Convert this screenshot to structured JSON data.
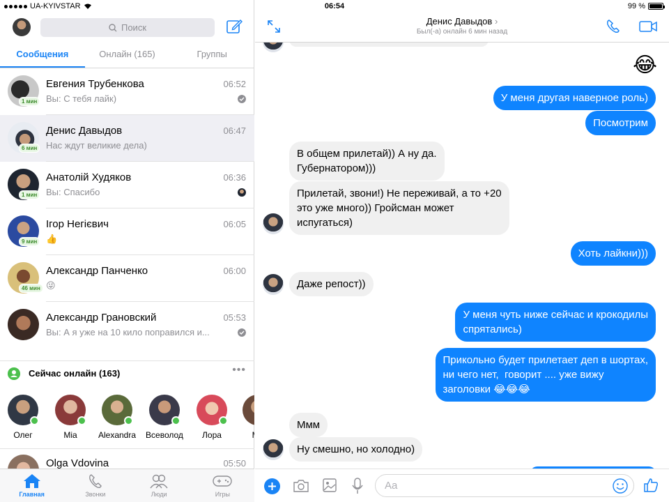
{
  "status_bar": {
    "carrier": "UA-KYIVSTAR",
    "time": "06:54",
    "battery": "99 %",
    "battery_level": 0.99
  },
  "sidebar": {
    "search_placeholder": "Поиск",
    "tabs": [
      {
        "label": "Сообщения",
        "active": true
      },
      {
        "label": "Онлайн (165)",
        "active": false
      },
      {
        "label": "Группы",
        "active": false
      }
    ],
    "conversations": [
      {
        "name": "Евгения Трубенкова",
        "preview": "Вы: С тебя лайк)",
        "time": "06:52",
        "active_badge": "1 мин",
        "status": "sent-check",
        "selected": false
      },
      {
        "name": "Денис Давыдов",
        "preview": "Нас ждут великие дела)",
        "time": "06:47",
        "active_badge": "6 мин",
        "status": "",
        "selected": true
      },
      {
        "name": "Анатолій Худяков",
        "preview": "Вы: Спасибо",
        "time": "06:36",
        "active_badge": "1 мин",
        "status": "seen-avatar",
        "selected": false
      },
      {
        "name": "Ігор Негієвич",
        "preview": "👍",
        "time": "06:05",
        "active_badge": "9 мин",
        "status": "",
        "selected": false
      },
      {
        "name": "Александр Панченко",
        "preview": "😜",
        "time": "06:00",
        "active_badge": "46 мин",
        "status": "",
        "selected": false
      },
      {
        "name": "Александр Грановский",
        "preview": "Вы: А я уже на 10 кило поправился и...",
        "time": "05:53",
        "active_badge": "",
        "status": "sent-check",
        "selected": false
      }
    ],
    "online_section_title": "Сейчас онлайн (163)",
    "online_people": [
      "Олег",
      "Mia",
      "Alexandra",
      "Всеволод",
      "Лора",
      "Ми"
    ],
    "partial_conversation": {
      "name": "Olga Vdovina",
      "time": "05:50"
    },
    "bottom_tabs": [
      {
        "label": "Главная",
        "icon": "home-icon",
        "active": true
      },
      {
        "label": "Звонки",
        "icon": "phone-icon",
        "active": false
      },
      {
        "label": "Люди",
        "icon": "people-icon",
        "active": false
      },
      {
        "label": "Игры",
        "icon": "gamepad-icon",
        "active": false
      }
    ]
  },
  "chat": {
    "contact_name": "Денис Давыдов",
    "contact_status": "Был(-а) онлайн 6 мин назад",
    "messages": [
      {
        "dir": "out",
        "text": "😂",
        "emoji_only": true
      },
      {
        "dir": "out",
        "text": "У меня другая наверное роль)"
      },
      {
        "dir": "out",
        "text": "Посмотрим"
      },
      {
        "dir": "in",
        "text": "В общем прилетай)) А ну да.\nГубернатором)))"
      },
      {
        "dir": "in",
        "text": "Прилетай, звони!) Не переживай, а то +20\nэто уже много)) Гройсман может\nиспугаться)"
      },
      {
        "dir": "out",
        "text": "Хоть лайкни)))"
      },
      {
        "dir": "in",
        "text": "Даже репост))"
      },
      {
        "dir": "out",
        "text": "У меня чуть ниже сейчас и крокодилы\nспрятались)"
      },
      {
        "dir": "out",
        "text": "Прикольно будет прилетает деп в шортах,\nни чего нет,  говорит .... уже вижу\nзаголовки 😂😂😂"
      },
      {
        "dir": "in",
        "text": "Ммм"
      },
      {
        "dir": "in",
        "text": "Ну смешно, но холодно)"
      }
    ],
    "composer_placeholder": "Aa"
  },
  "colors": {
    "accent": "#1a84f5",
    "outgoing_bubble": "#0f84ff",
    "incoming_bubble": "#f0f0f0",
    "online": "#4cc04d"
  }
}
